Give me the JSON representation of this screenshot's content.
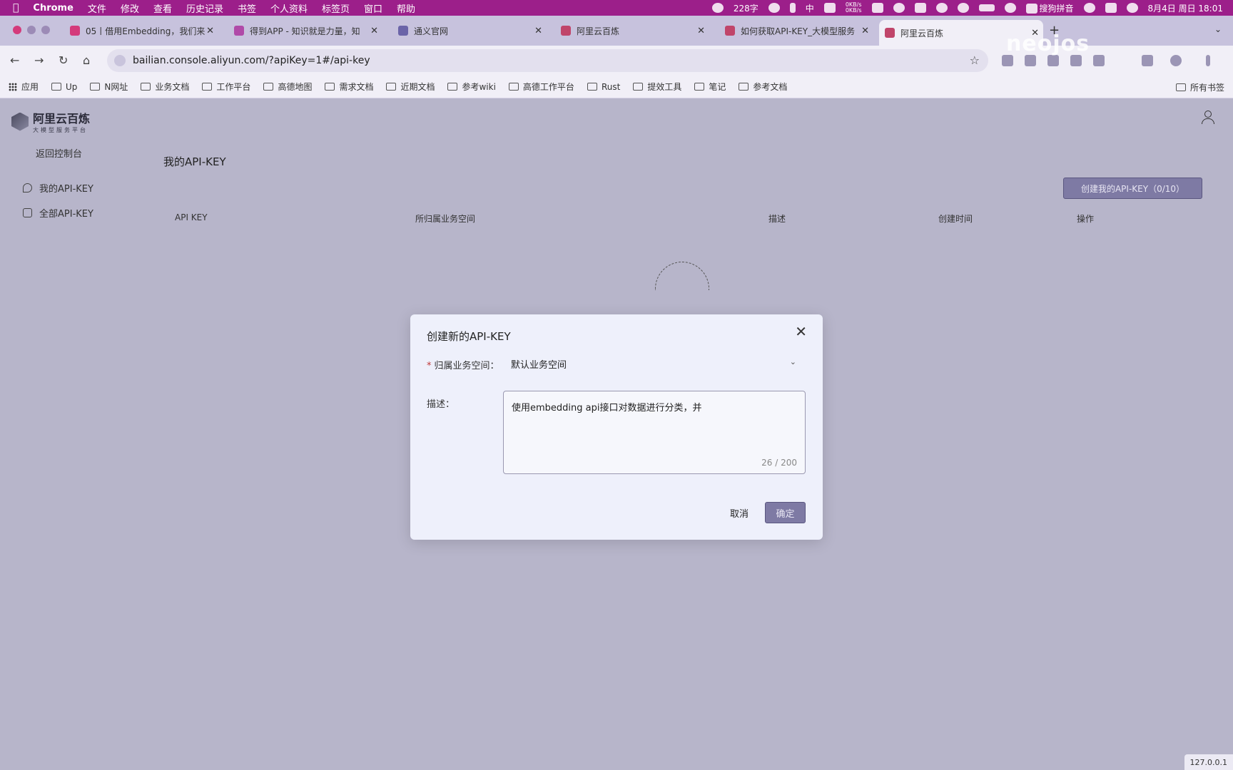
{
  "menubar": {
    "app": "Chrome",
    "items": [
      "文件",
      "修改",
      "查看",
      "历史记录",
      "书签",
      "个人资料",
      "标签页",
      "窗口",
      "帮助"
    ],
    "word_count": "228字",
    "net_up": "0KB/s",
    "net_down": "0KB/s",
    "input_method": "搜狗拼音",
    "input_char": "中",
    "datetime": "8月4日 周日  18:01"
  },
  "tabs": [
    {
      "title": "05丨借用Embedding，我们来",
      "color": "#d43a7b"
    },
    {
      "title": "得到APP - 知识就是力量，知",
      "color": "#b04aa8"
    },
    {
      "title": "通义官网",
      "color": "#6b64a8"
    },
    {
      "title": "阿里云百炼",
      "color": "#c0456a"
    },
    {
      "title": "如何获取API-KEY_大模型服务",
      "color": "#c0456a"
    },
    {
      "title": "阿里云百炼",
      "color": "#c0456a"
    }
  ],
  "toolbar": {
    "url": "bailian.console.aliyun.com/?apiKey=1#/api-key",
    "watermark": "neojos"
  },
  "bookmarks": [
    "应用",
    "Up",
    "N网址",
    "业务文档",
    "工作平台",
    "高德地图",
    "需求文档",
    "近期文档",
    "参考wiki",
    "高德工作平台",
    "Rust",
    "提效工具",
    "笔记",
    "参考文档"
  ],
  "bookmarks_all": "所有书签",
  "page": {
    "logo_name": "阿里云百炼",
    "logo_sub": "大模型服务平台",
    "back": "返回控制台",
    "side_items": [
      "我的API-KEY",
      "全部API-KEY"
    ],
    "title": "我的API-KEY",
    "create_button": "创建我的API-KEY（0/10）",
    "columns": [
      "API KEY",
      "所归属业务空间",
      "描述",
      "创建时间",
      "操作"
    ]
  },
  "modal": {
    "title": "创建新的API-KEY",
    "workspace_label": "归属业务空间：",
    "workspace_value": "默认业务空间",
    "desc_label": "描述：",
    "desc_value": "使用embedding api接口对数据进行分类，并",
    "counter": "26 / 200",
    "cancel": "取消",
    "ok": "确定"
  },
  "status": "127.0.0.1"
}
